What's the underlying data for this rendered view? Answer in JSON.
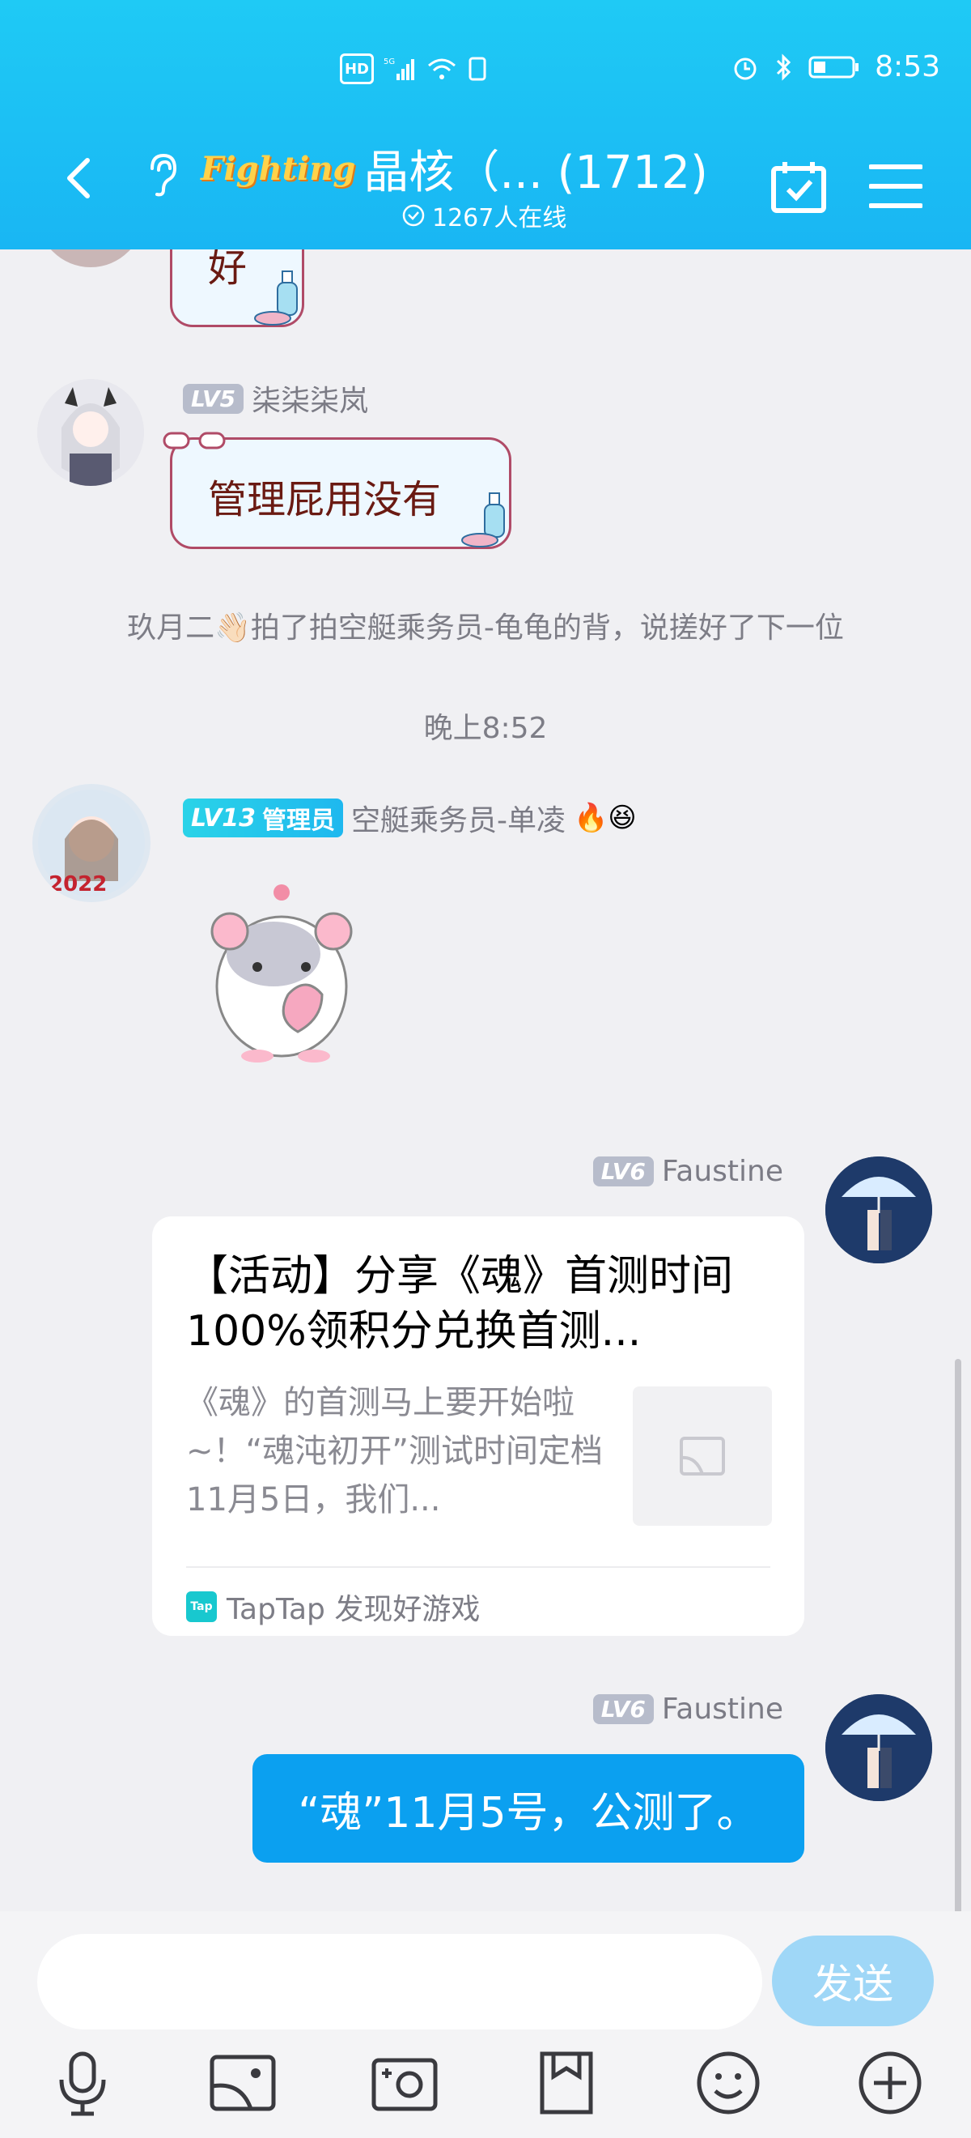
{
  "status": {
    "time": "8:53"
  },
  "header": {
    "logo_text": "Fighting",
    "title": "晶核（... (1712)",
    "online": "1267人在线"
  },
  "messages": {
    "m1": {
      "text": "好"
    },
    "m2": {
      "level": "LV5",
      "name": "柒柒柒岚",
      "text": "管理屁用没有"
    },
    "sys1": "玖月二👋🏻拍了拍空艇乘务员-龟龟的背，说搓好了下一位",
    "time1": "晚上8:52",
    "m3": {
      "level": "LV13",
      "admin": "管理员",
      "name": "空艇乘务员-单凌",
      "emoji": "🔥😆"
    },
    "m4": {
      "level": "LV6",
      "name": "Faustine",
      "card_title": "【活动】分享《魂》首测时间 100%领积分兑换首测...",
      "card_desc": "《魂》的首测马上要开始啦~！“魂沌初开”测试时间定档11月5日，我们...",
      "card_source": "TapTap 发现好游戏",
      "tap_label": "Tap"
    },
    "m5": {
      "level": "LV6",
      "name": "Faustine",
      "text": "“魂”11月5号，公测了。"
    }
  },
  "input": {
    "send_label": "发送"
  },
  "colors": {
    "header": "#19b6f3",
    "send_bubble": "#0ba0f0",
    "send_button": "#9fd7f7"
  }
}
